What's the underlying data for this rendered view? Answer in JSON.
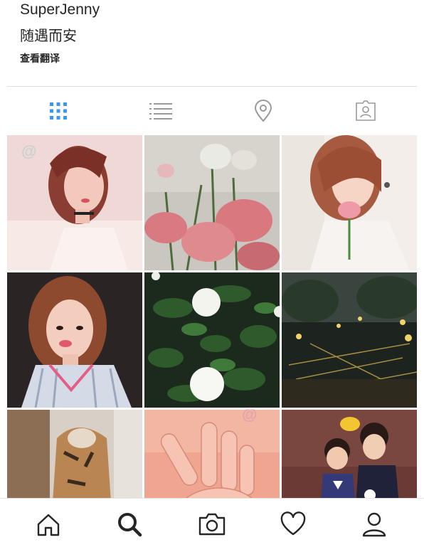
{
  "profile": {
    "username": "SuperJenny",
    "bio": "随遇而安",
    "translate_link": "查看翻译"
  },
  "tabs": [
    {
      "name": "grid-view",
      "icon": "grid-icon",
      "active": true
    },
    {
      "name": "list-view",
      "icon": "list-icon",
      "active": false
    },
    {
      "name": "location-view",
      "icon": "location-pin-icon",
      "active": false
    },
    {
      "name": "tagged-view",
      "icon": "tagged-person-icon",
      "active": false
    }
  ],
  "photos": [
    {
      "subject": "woman selfie pink shirt"
    },
    {
      "subject": "pink roses"
    },
    {
      "subject": "woman with pink flower"
    },
    {
      "subject": "woman selfie striped shirt"
    },
    {
      "subject": "white roses"
    },
    {
      "subject": "garden lights at night"
    },
    {
      "subject": "tiger print hoodie"
    },
    {
      "subject": "hand"
    },
    {
      "subject": "two children"
    }
  ],
  "bottom_nav": [
    {
      "name": "home",
      "icon": "home-icon"
    },
    {
      "name": "search",
      "icon": "search-icon",
      "active": true
    },
    {
      "name": "camera",
      "icon": "camera-icon"
    },
    {
      "name": "activity",
      "icon": "heart-icon"
    },
    {
      "name": "profile",
      "icon": "profile-icon"
    }
  ],
  "colors": {
    "active_tab": "#3897f0",
    "inactive_icon": "#999999",
    "divider": "#dbdbdb",
    "text": "#262626"
  }
}
